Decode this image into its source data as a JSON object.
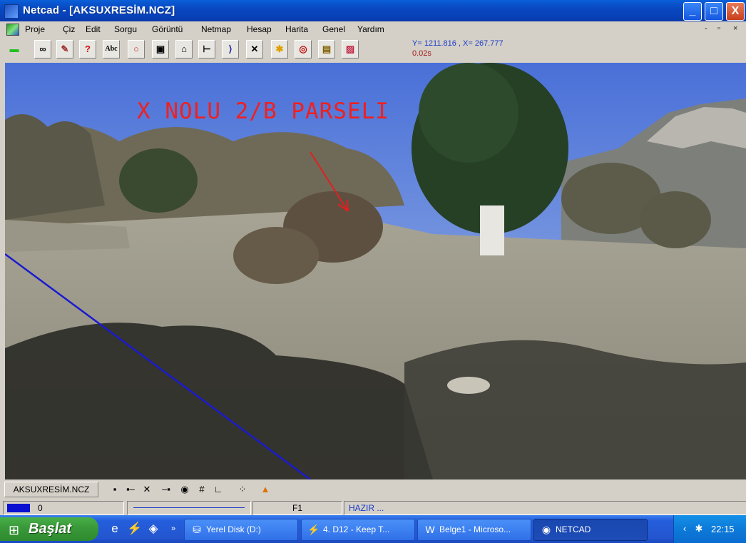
{
  "window": {
    "title": "Netcad - [AKSUXRESİM.NCZ]",
    "controls": {
      "minimize": "_",
      "maximize": "□",
      "close": "X"
    }
  },
  "menu": {
    "items": [
      "Proje",
      "Çiz",
      "Edit",
      "Sorgu",
      "Görüntü",
      "Netmap",
      "Hesap",
      "Harita",
      "Genel",
      "Yardım"
    ],
    "mdi_controls": {
      "minimize": "-",
      "restore": "▫",
      "close": "×"
    }
  },
  "toolbar": {
    "tools": [
      "line-icon",
      "binoculars-icon",
      "pen-icon",
      "help-icon",
      "text-icon",
      "circle-icon",
      "frame-icon",
      "building-icon",
      "dimension-icon",
      "angle-icon",
      "intersect-icon",
      "color-icon",
      "hatch-icon",
      "table-icon",
      "pattern-icon"
    ],
    "coordinates": "Y= 1211.816 , X= 267.777",
    "timing": "0.02s"
  },
  "canvas": {
    "label": "X NOLU 2/B PARSELI",
    "colors": {
      "label": "#f02020",
      "line": "#1a1ad0",
      "arrow": "#e02020"
    }
  },
  "drawbar": {
    "file_tab": "AKSUXRESİM.NCZ",
    "snap_icons": [
      "snap-end-icon",
      "snap-mid-icon",
      "snap-intersect-icon",
      "snap-nearest-icon",
      "snap-center-icon",
      "snap-grid-icon",
      "snap-perpendicular-icon",
      "snap-points-icon",
      "triangle-warning-icon"
    ]
  },
  "statusbar": {
    "layer": "0",
    "layer_color": "#0a10d0",
    "function_key": "F1",
    "status": "HAZIR ..."
  },
  "taskbar": {
    "start_label": "Başlat",
    "tasks": [
      {
        "label": "Yerel Disk (D:)",
        "icon": "drive-icon"
      },
      {
        "label": "4. D12 - Keep T...",
        "icon": "winamp-icon"
      },
      {
        "label": "Belge1 - Microso...",
        "icon": "word-icon"
      },
      {
        "label": "NETCAD",
        "icon": "netcad-icon",
        "active": true
      }
    ],
    "clock": "22:15"
  }
}
